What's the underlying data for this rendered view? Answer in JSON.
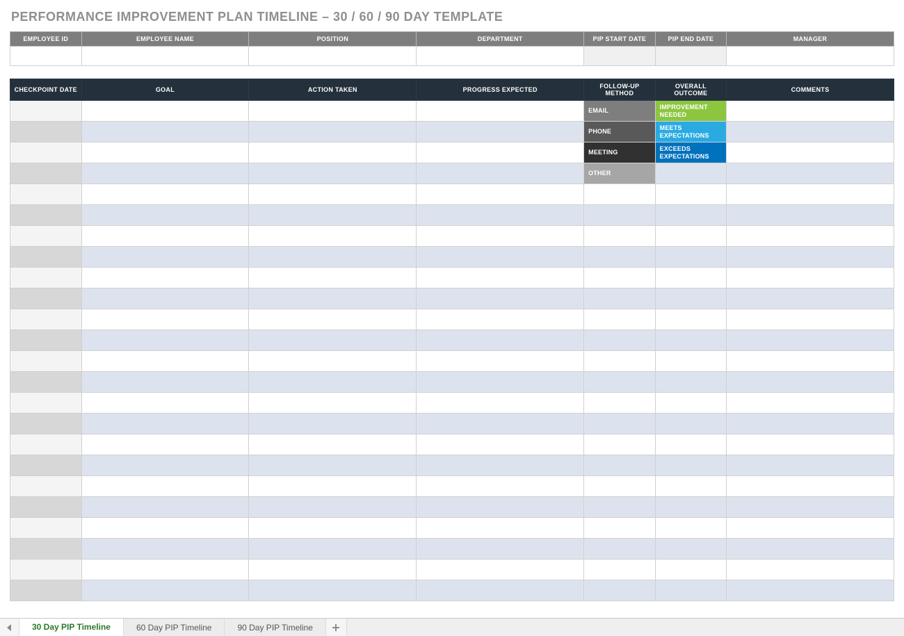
{
  "title": "PERFORMANCE IMPROVEMENT PLAN TIMELINE  –  30 / 60 / 90 DAY TEMPLATE",
  "info_headers": {
    "employee_id": "EMPLOYEE ID",
    "employee_name": "EMPLOYEE NAME",
    "position": "POSITION",
    "department": "DEPARTMENT",
    "pip_start": "PIP START DATE",
    "pip_end": "PIP END DATE",
    "manager": "MANAGER"
  },
  "grid_headers": {
    "checkpoint": "CHECKPOINT DATE",
    "goal": "GOAL",
    "action": "ACTION TAKEN",
    "progress": "PROGRESS EXPECTED",
    "followup": "FOLLOW-UP METHOD",
    "outcome": "OVERALL OUTCOME",
    "comments": "COMMENTS"
  },
  "followup_legend": {
    "email": "EMAIL",
    "phone": "PHONE",
    "meeting": "MEETING",
    "other": "OTHER"
  },
  "outcome_legend": {
    "improve": "IMPROVEMENT NEEDED",
    "meets": "MEETS EXPECTATIONS",
    "exceeds": "EXCEEDS EXPECTATIONS"
  },
  "row_count": 24,
  "tabs": {
    "t30": "30 Day PIP Timeline",
    "t60": "60 Day PIP Timeline",
    "t90": "90 Day PIP Timeline"
  }
}
